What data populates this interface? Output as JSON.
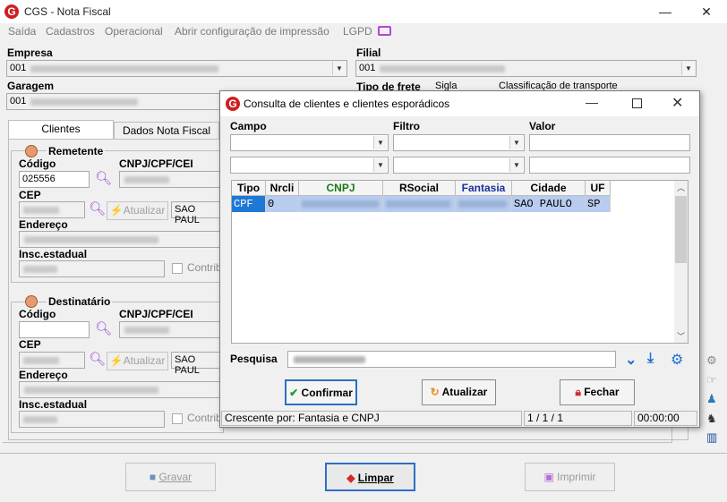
{
  "window": {
    "title": "CGS - Nota Fiscal",
    "logo": "G",
    "minimize": "—",
    "close": "✕"
  },
  "menu": [
    "Saída",
    "Cadastros",
    "Operacional",
    "Abrir configuração de impressão",
    "LGPD"
  ],
  "header": {
    "empresa_label": "Empresa",
    "empresa_value": "001",
    "filial_label": "Filial",
    "filial_value": "001",
    "garagem_label": "Garagem",
    "garagem_value": "001",
    "tipo_frete_label": "Tipo de frete",
    "sigla_label": "Sigla",
    "classificacao_label": "Classificação de transporte"
  },
  "tabs": [
    "Clientes",
    "Dados Nota Fiscal"
  ],
  "remetente": {
    "title": "Remetente",
    "codigo_label": "Código",
    "codigo_value": "025556",
    "cnpj_label": "CNPJ/CPF/CEI",
    "cep_label": "CEP",
    "atualizar_label": "Atualizar",
    "cidade_value": "SAO PAUL",
    "endereco_label": "Endereço",
    "insc_label": "Insc.estadual",
    "contrib_label": "Contribu"
  },
  "destinatario": {
    "title": "Destinatário",
    "codigo_label": "Código",
    "codigo_value": "",
    "cnpj_label": "CNPJ/CPF/CEI",
    "cep_label": "CEP",
    "atualizar_label": "Atualizar",
    "cidade_value": "SAO PAUL",
    "endereco_label": "Endereço",
    "insc_label": "Insc.estadual",
    "contrib_label": "Contribu"
  },
  "bottom_buttons": {
    "gravar": "Gravar",
    "limpar": "Limpar",
    "imprimir": "Imprimir"
  },
  "dialog": {
    "title": "Consulta de clientes e clientes esporádicos",
    "campo_label": "Campo",
    "filtro_label": "Filtro",
    "valor_label": "Valor",
    "columns": [
      {
        "label": "Tipo",
        "color": "#000000"
      },
      {
        "label": "Nrcli",
        "color": "#000000"
      },
      {
        "label": "CNPJ",
        "color": "#1a7a1a"
      },
      {
        "label": "RSocial",
        "color": "#000000"
      },
      {
        "label": "Fantasia",
        "color": "#1a2fa0"
      },
      {
        "label": "Cidade",
        "color": "#000000"
      },
      {
        "label": "UF",
        "color": "#000000"
      }
    ],
    "row": {
      "tipo": "CPF",
      "nrcli": "0",
      "cidade": "SAO PAULO",
      "uf": "SP"
    },
    "pesquisa_label": "Pesquisa",
    "confirmar": "Confirmar",
    "atualizar": "Atualizar",
    "fechar": "Fechar",
    "status": {
      "order": "Crescente por: Fantasia e CNPJ",
      "pages": "1 / 1 / 1",
      "time": "00:00:00"
    }
  }
}
